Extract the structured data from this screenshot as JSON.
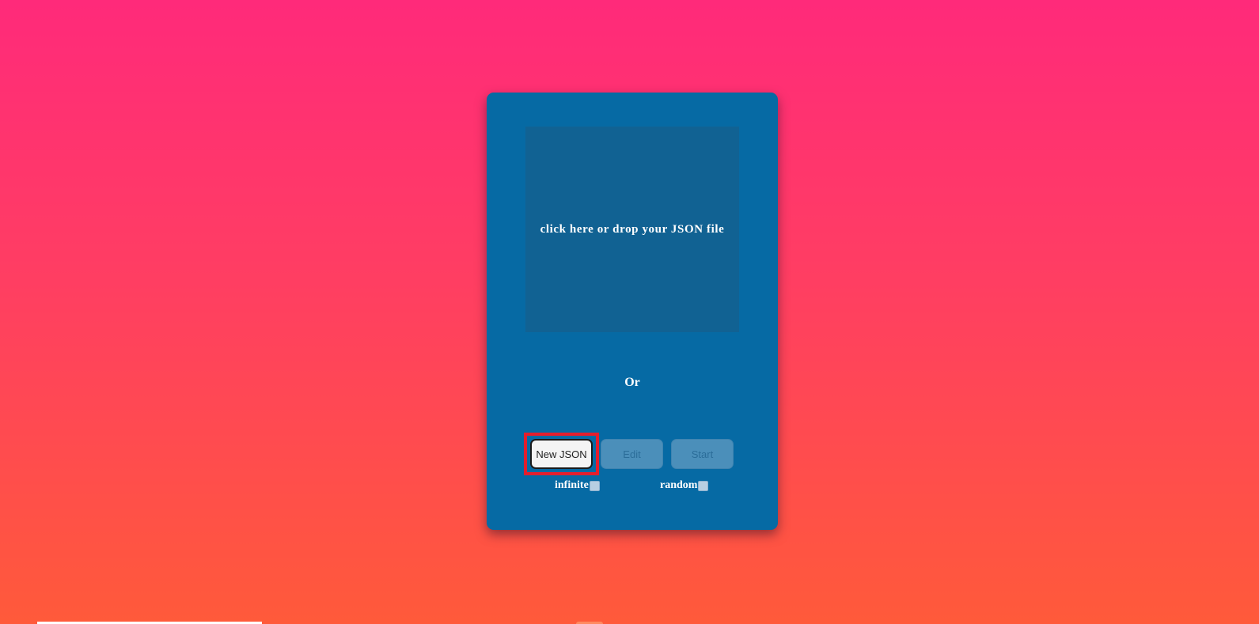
{
  "uploader": {
    "dropzone_text": "click here or drop your JSON file",
    "or_text": "Or"
  },
  "buttons": {
    "new_json": "New JSON",
    "edit": "Edit",
    "start": "Start"
  },
  "options": {
    "infinite_label": "infinite",
    "infinite_checked": false,
    "random_label": "random",
    "random_checked": false
  },
  "colors": {
    "card": "#066aa4",
    "dropzone": "#116293",
    "highlight": "#e41e2d"
  }
}
